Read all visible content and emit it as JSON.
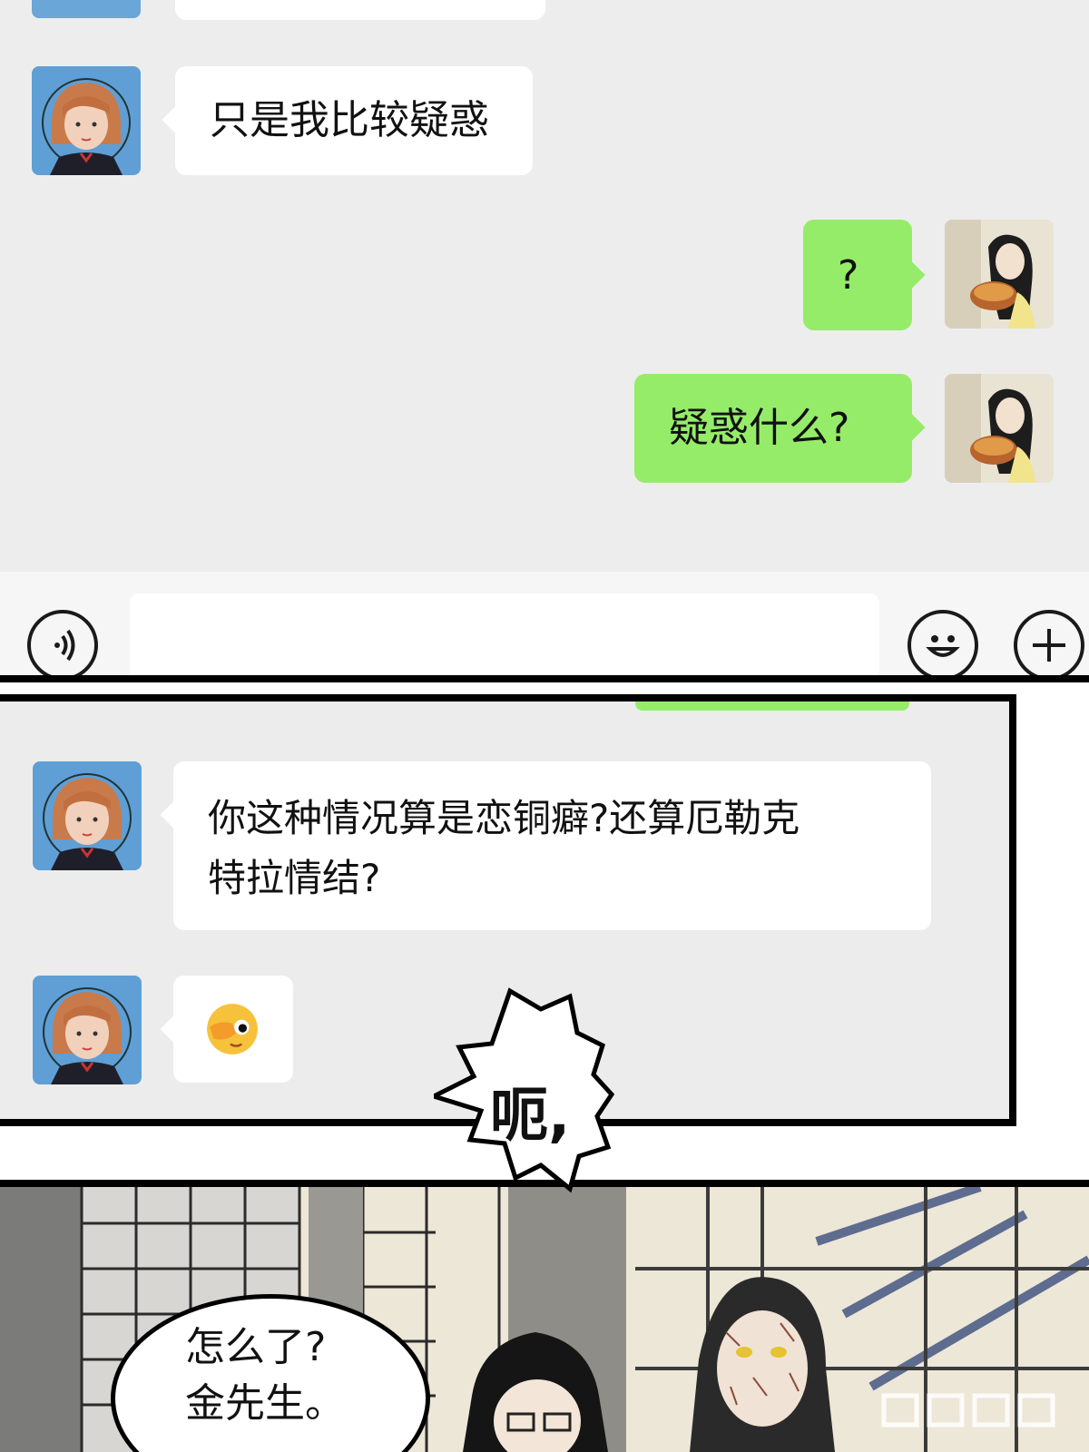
{
  "chat_screen": {
    "messages": [
      {
        "side": "incoming",
        "sender_avatar": "orange-hair-girl-avatar",
        "text": "只是我比较疑惑"
      },
      {
        "side": "outgoing",
        "sender_avatar": "dark-hair-woman-avatar",
        "text": "?"
      },
      {
        "side": "outgoing",
        "sender_avatar": "dark-hair-woman-avatar",
        "text": "疑惑什么?"
      }
    ],
    "input_bar": {
      "voice_icon": "voice-icon",
      "emoji_icon": "smiley-icon",
      "plus_icon": "plus-icon"
    },
    "colors": {
      "background": "#ededed",
      "incoming_bubble": "#ffffff",
      "outgoing_bubble": "#95ec69"
    }
  },
  "chat_screen_2": {
    "messages": [
      {
        "side": "incoming",
        "sender_avatar": "orange-hair-girl-avatar",
        "lines": [
          "你这种情况算是恋铜癖?还算厄勒克",
          "特拉情结?"
        ]
      },
      {
        "side": "incoming",
        "sender_avatar": "orange-hair-girl-avatar",
        "emoji": "face-palm-peek-emoji"
      }
    ]
  },
  "burst": {
    "text": "呃,"
  },
  "scene": {
    "speech": [
      "怎么了?",
      "金先生。"
    ]
  }
}
